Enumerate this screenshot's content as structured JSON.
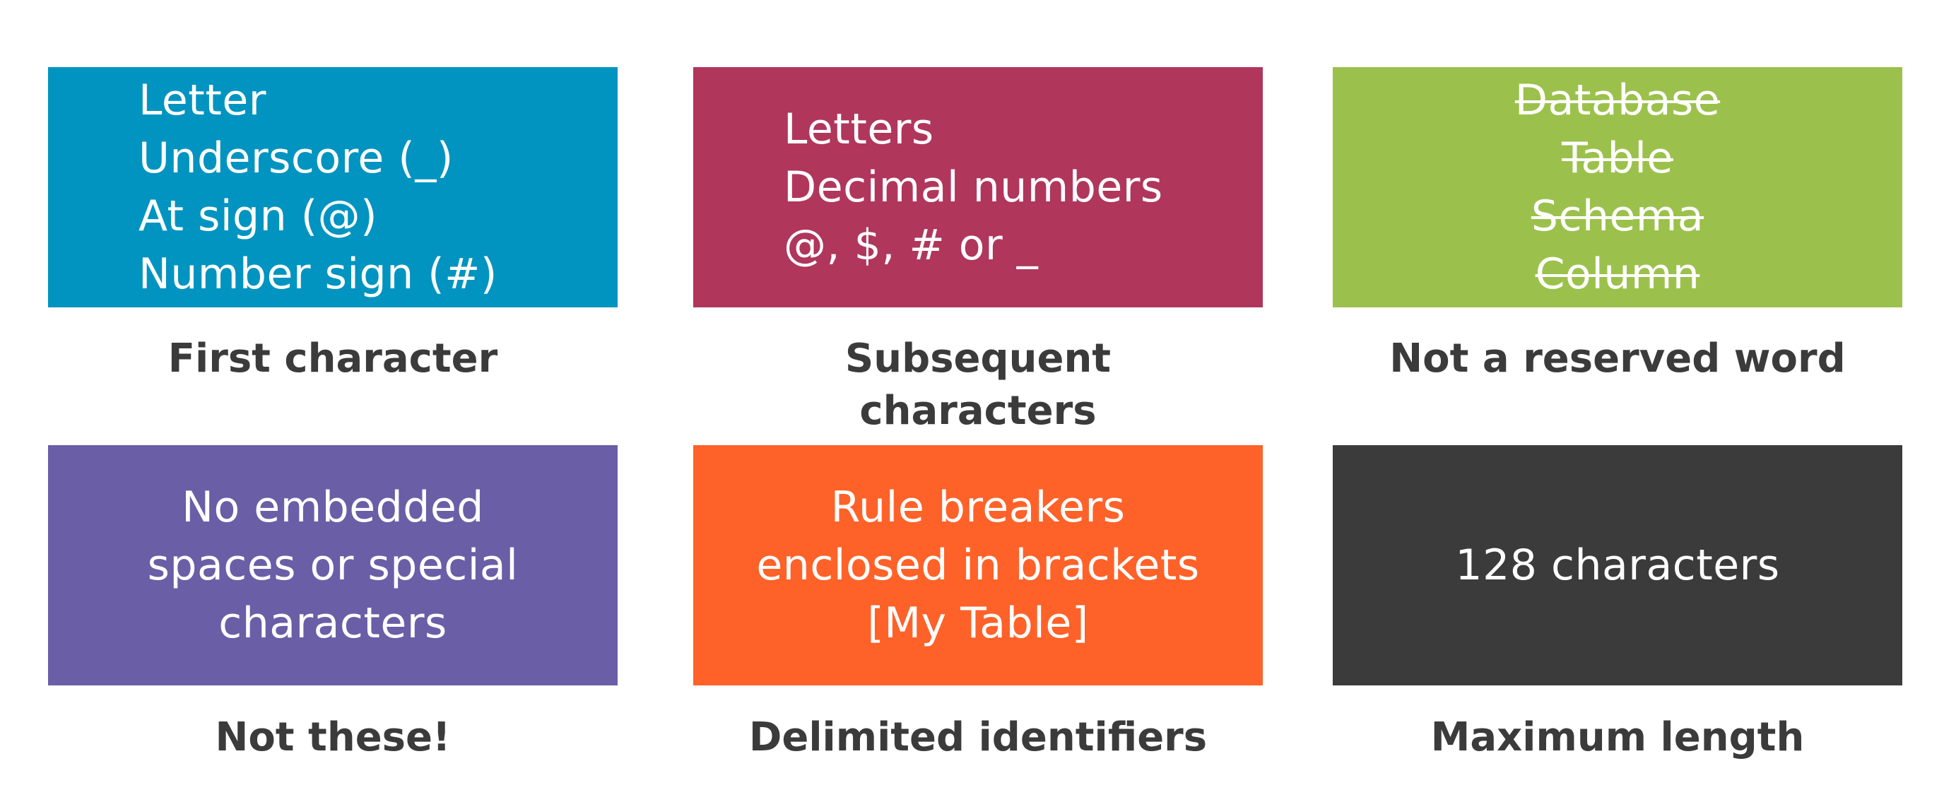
{
  "cards": [
    {
      "lines": [
        "Letter",
        "Underscore (_)",
        "At sign (@)",
        "Number sign (#)"
      ],
      "caption": "First character",
      "color": "#0194c0"
    },
    {
      "lines": [
        "Letters",
        "Decimal numbers",
        "@, $, # or _"
      ],
      "caption_lines": [
        "Subsequent",
        "characters"
      ],
      "color": "#b0365c"
    },
    {
      "lines": [
        "Database",
        "Table",
        "Schema",
        "Column"
      ],
      "caption": "Not a reserved word",
      "color": "#9bc14c",
      "struck_through": true
    },
    {
      "lines": [
        "No embedded",
        "spaces or special",
        "characters"
      ],
      "caption": "Not these!",
      "color": "#6a5ea7"
    },
    {
      "lines": [
        "Rule breakers",
        "enclosed in brackets",
        "[My Table]"
      ],
      "caption": "Delimited identifiers",
      "color": "#fe6229"
    },
    {
      "lines": [
        "128 characters"
      ],
      "caption": "Maximum length",
      "color": "#3b3b3b"
    }
  ]
}
